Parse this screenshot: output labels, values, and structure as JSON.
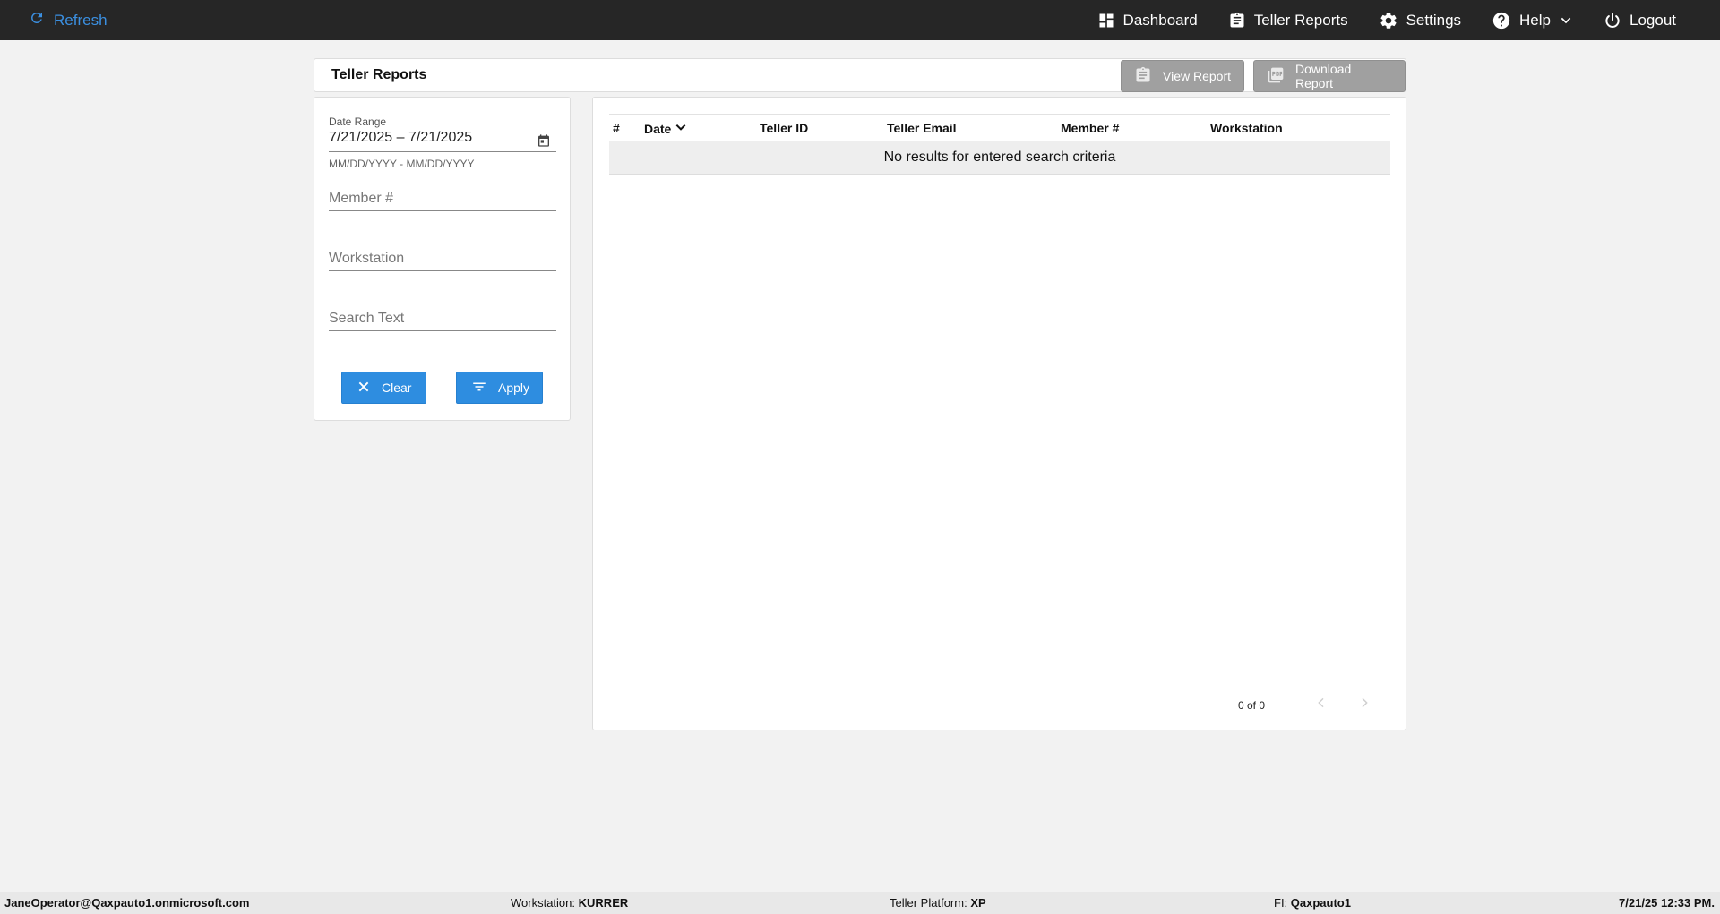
{
  "topbar": {
    "refresh_label": "Refresh",
    "nav": {
      "dashboard": "Dashboard",
      "teller_reports": "Teller Reports",
      "settings": "Settings",
      "help": "Help",
      "logout": "Logout"
    }
  },
  "header": {
    "title": "Teller Reports",
    "view_report": "View Report",
    "download_report": "Download Report"
  },
  "filters": {
    "date_range_label": "Date Range",
    "date_range_value": "7/21/2025 – 7/21/2025",
    "date_range_hint": "MM/DD/YYYY - MM/DD/YYYY",
    "member_placeholder": "Member #",
    "workstation_placeholder": "Workstation",
    "search_placeholder": "Search Text",
    "clear_label": "Clear",
    "apply_label": "Apply"
  },
  "table": {
    "columns": [
      "#",
      "Date",
      "Teller ID",
      "Teller Email",
      "Member #",
      "Workstation"
    ],
    "empty_message": "No results for entered search criteria",
    "pager": "0 of 0"
  },
  "footer": {
    "user": "JaneOperator@Qaxpauto1.onmicrosoft.com",
    "workstation_label": "Workstation:",
    "workstation_value": "KURRER",
    "platform_label": "Teller Platform:",
    "platform_value": "XP",
    "fi_label": "FI:",
    "fi_value": "Qaxpauto1",
    "timestamp": "7/21/25 12:33 PM."
  },
  "colors": {
    "topbar_bg": "#262626",
    "accent": "#2e8de0",
    "disabled_button": "#a0a0a0"
  }
}
